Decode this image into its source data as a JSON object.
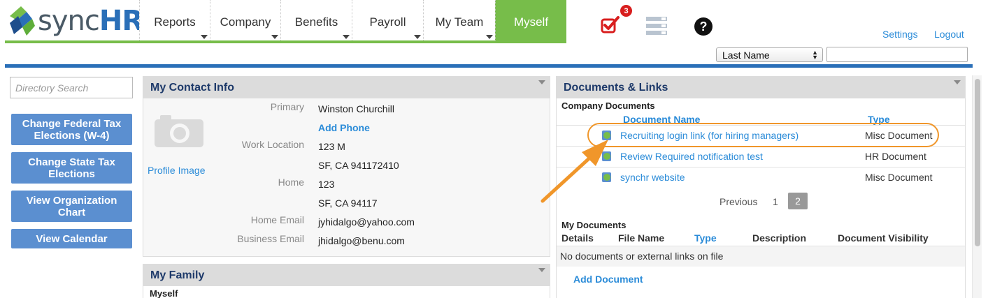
{
  "brand": {
    "name_prefix": "sync",
    "name_suffix": "HR",
    "accent_green": "#77bd4a",
    "accent_blue": "#2a6fb8"
  },
  "nav": {
    "items": [
      {
        "label": "Reports",
        "has_menu": true
      },
      {
        "label": "Company",
        "has_menu": true
      },
      {
        "label": "Benefits",
        "has_menu": true
      },
      {
        "label": "Payroll",
        "has_menu": true
      },
      {
        "label": "My Team",
        "has_menu": true
      },
      {
        "label": "Myself",
        "has_menu": false,
        "active": true
      }
    ]
  },
  "header_icons": {
    "tasks_badge": "3",
    "tasks_icon": "checkbox-check-icon",
    "list_icon": "list-view-icon",
    "help_label": "?"
  },
  "top_links": {
    "settings": "Settings",
    "logout": "Logout"
  },
  "search": {
    "field_selected": "Last Name",
    "value": ""
  },
  "sidebar": {
    "directory_search_placeholder": "Directory Search",
    "buttons": [
      "Change Federal Tax Elections (W-4)",
      "Change State Tax Elections",
      "View Organization Chart",
      "View Calendar"
    ]
  },
  "contact": {
    "title": "My Contact Info",
    "profile_image_link": "Profile Image",
    "primary_label": "Primary",
    "primary_value": "Winston Churchill",
    "add_phone": "Add Phone",
    "work_location_label": "Work Location",
    "work_location_line1": "123 M",
    "work_location_line2": "SF, CA 941172410",
    "home_label": "Home",
    "home_line1": "123",
    "home_line2": "SF, CA 94117",
    "home_email_label": "Home Email",
    "home_email_value": "jyhidalgo@yahoo.com",
    "business_email_label": "Business Email",
    "business_email_value": "jhidalgo@benu.com"
  },
  "family": {
    "title": "My Family",
    "subtitle": "Myself"
  },
  "documents": {
    "title": "Documents & Links",
    "company_title": "Company Documents",
    "col_name": "Document Name",
    "col_type": "Type",
    "rows": [
      {
        "name": "Recruiting login link (for hiring managers)",
        "type": "Misc Document"
      },
      {
        "name": "Review Required notification test",
        "type": "HR Document"
      },
      {
        "name": "synchr website",
        "type": "Misc Document"
      }
    ],
    "pager_previous": "Previous",
    "pager_page1": "1",
    "pager_page2": "2",
    "my_title": "My Documents",
    "my_cols": [
      "Details",
      "File Name",
      "Type",
      "Description",
      "Document Visibility"
    ],
    "empty_message": "No documents or external links on file",
    "add_document": "Add Document"
  },
  "annotation": {
    "color": "#f0962a"
  }
}
